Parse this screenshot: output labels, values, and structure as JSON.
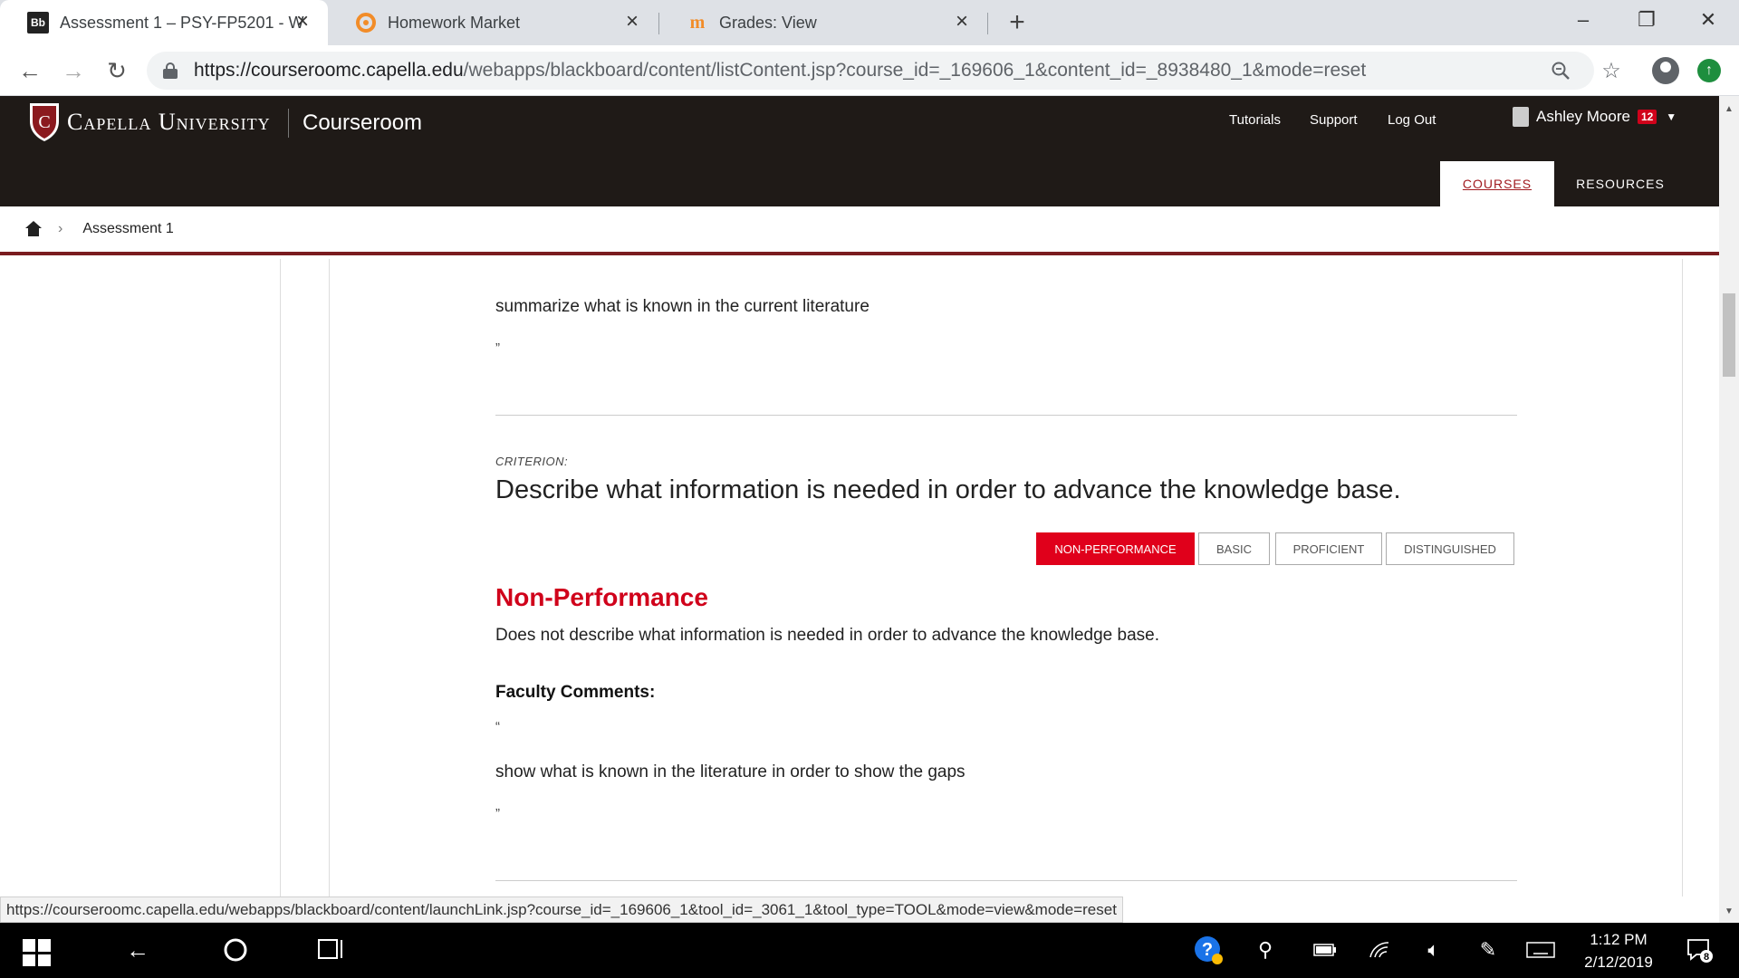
{
  "browser": {
    "tabs": [
      {
        "title": "Assessment 1 – PSY-FP5201 - Wi",
        "favicon": "Bb",
        "active": true
      },
      {
        "title": "Homework Market",
        "favicon": "homework-market-logo",
        "active": false
      },
      {
        "title": "Grades: View",
        "favicon": "m-logo",
        "active": false
      }
    ],
    "url_host": "https://courseroomc.capella.edu",
    "url_path": "/webapps/blackboard/content/listContent.jsp?course_id=_169606_1&content_id=_8938480_1&mode=reset"
  },
  "site": {
    "brand": "Capella University",
    "app_name": "Courseroom",
    "nav_links": [
      "Tutorials",
      "Support",
      "Log Out"
    ],
    "user_name": "Ashley Moore",
    "notification_count": "12",
    "main_tabs": {
      "courses": "COURSES",
      "resources": "RESOURCES"
    }
  },
  "breadcrumb": {
    "current": "Assessment 1"
  },
  "content": {
    "open_quote_top": "“",
    "prev_comment": "summarize what is known in the current literature",
    "close_quote_1": "”",
    "criterion_label": "CRITERION:",
    "criterion_title": "Describe what information is needed in order to advance the knowledge base.",
    "ratings": [
      {
        "label": "NON-PERFORMANCE",
        "selected": true
      },
      {
        "label": "BASIC",
        "selected": false
      },
      {
        "label": "PROFICIENT",
        "selected": false
      },
      {
        "label": "DISTINGUISHED",
        "selected": false
      }
    ],
    "level_title": "Non-Performance",
    "level_description": "Does not describe what information is needed in order to advance the knowledge base.",
    "faculty_heading": "Faculty Comments:",
    "open_quote_2": "“",
    "faculty_comment": "show what is known in the literature in order to show the gaps",
    "close_quote_2": "”"
  },
  "status_url": "https://courseroomc.capella.edu/webapps/blackboard/content/launchLink.jsp?course_id=_169606_1&tool_id=_3061_1&tool_type=TOOL&mode=view&mode=reset",
  "taskbar": {
    "time": "1:12 PM",
    "date": "2/12/2019",
    "notification_count": "8"
  },
  "colors": {
    "brand_dark": "#1f1a17",
    "accent_red": "#d0021b",
    "courses_red": "#a11b20"
  }
}
